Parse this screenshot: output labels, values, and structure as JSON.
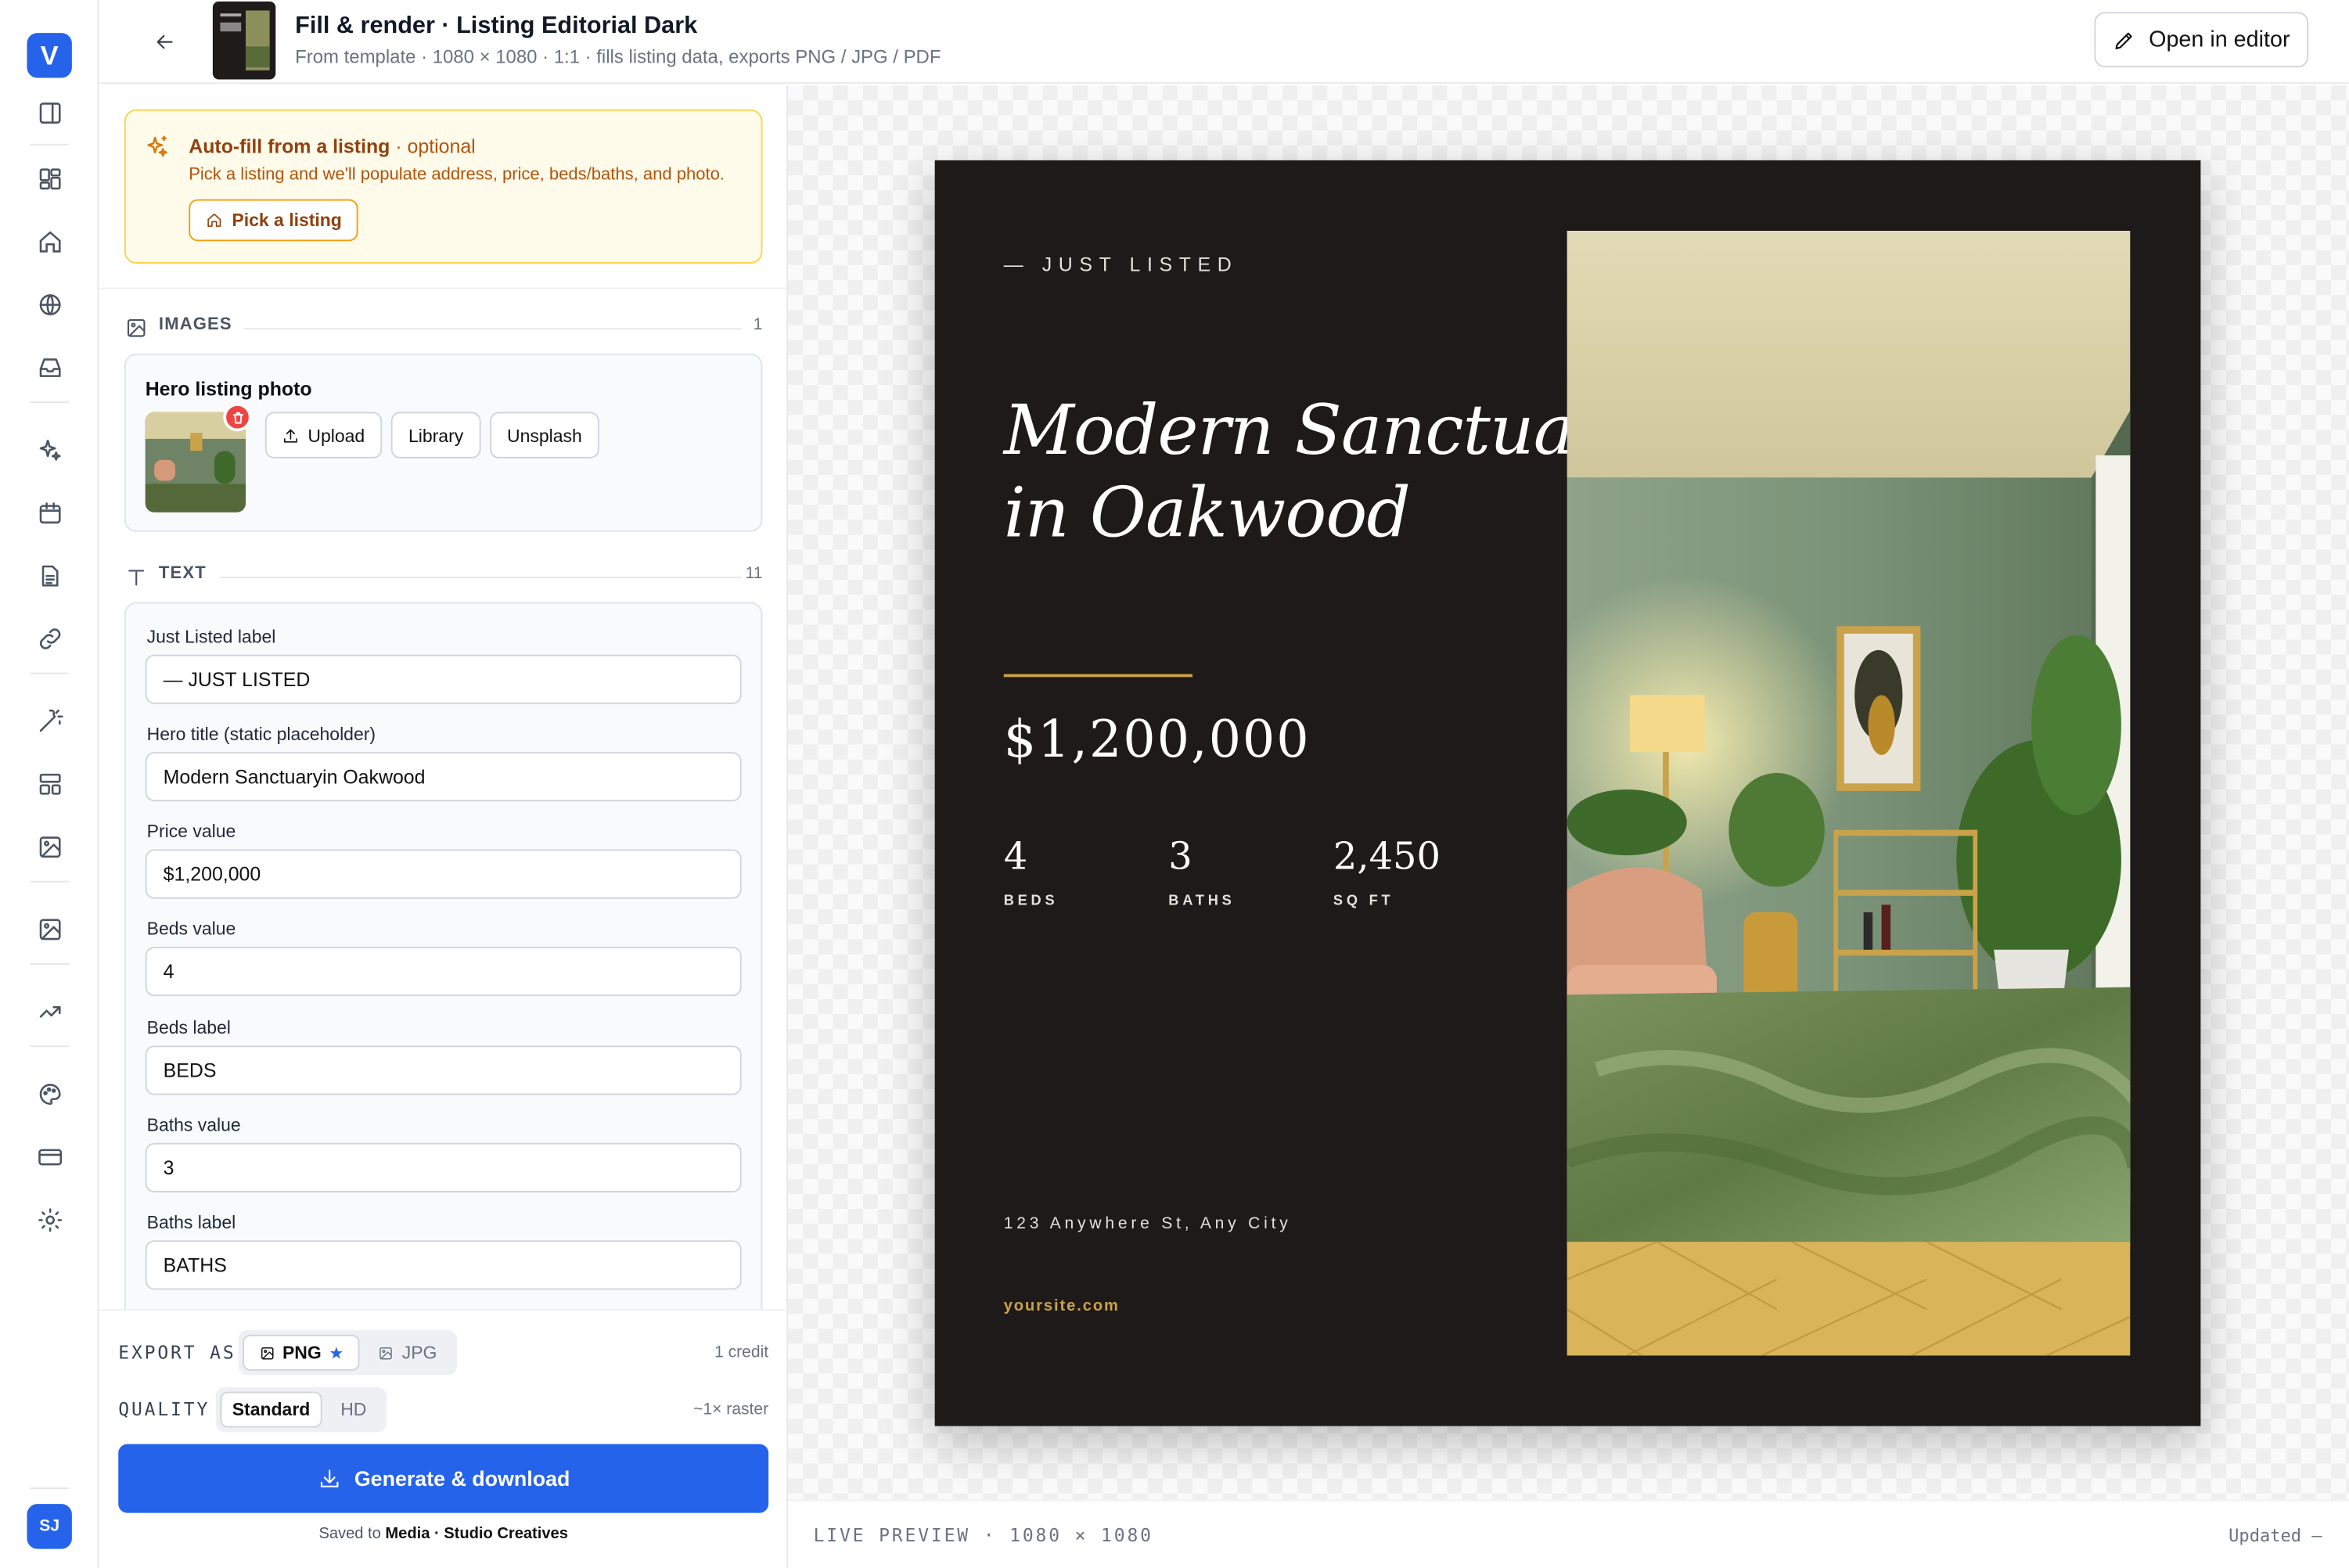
{
  "app": {
    "brand_letter": "V",
    "user_initials": "SJ"
  },
  "rail": {
    "icons": [
      "sidebar-toggle-icon",
      "dashboard-icon",
      "home-icon",
      "globe-icon",
      "inbox-icon",
      "sparkles-icon",
      "calendar-icon",
      "document-icon",
      "link-icon",
      "magic-wand-icon",
      "layout-icon",
      "image-icon",
      "image-gallery-icon",
      "trending-icon",
      "palette-icon",
      "credit-card-icon",
      "settings-icon"
    ]
  },
  "header": {
    "title": "Fill & render · Listing Editorial Dark",
    "subtitle": "From template · 1080 × 1080 · 1:1 · fills listing data, exports PNG / JPG / PDF",
    "open_editor_label": "Open in editor"
  },
  "autofill": {
    "title": "Auto-fill from a listing",
    "optional": " · optional",
    "description": "Pick a listing and we'll populate address, price, beds/baths, and photo.",
    "button_label": "Pick a listing"
  },
  "images_section": {
    "label": "IMAGES",
    "count": "1",
    "card_title": "Hero listing photo",
    "buttons": {
      "upload": "Upload",
      "library": "Library",
      "unsplash": "Unsplash"
    }
  },
  "text_section": {
    "label": "TEXT",
    "count": "11",
    "fields": [
      {
        "label": "Just Listed label",
        "value": "— JUST LISTED"
      },
      {
        "label": "Hero title (static placeholder)",
        "value": "Modern Sanctuaryin Oakwood"
      },
      {
        "label": "Price value",
        "value": "$1,200,000"
      },
      {
        "label": "Beds value",
        "value": "4"
      },
      {
        "label": "Beds label",
        "value": "BEDS"
      },
      {
        "label": "Baths value",
        "value": "3"
      },
      {
        "label": "Baths label",
        "value": "BATHS"
      }
    ]
  },
  "export": {
    "export_as_label": "EXPORT AS",
    "formats": [
      {
        "label": "PNG",
        "selected": true
      },
      {
        "label": "JPG",
        "selected": false
      }
    ],
    "credit": "1 credit",
    "quality_label": "QUALITY",
    "qualities": [
      {
        "label": "Standard",
        "selected": true
      },
      {
        "label": "HD",
        "selected": false
      }
    ],
    "raster": "~1× raster",
    "generate_label": "Generate & download",
    "saved_prefix": "Saved to ",
    "saved_location": "Media · Studio Creatives"
  },
  "preview": {
    "label": "— JUST LISTED",
    "title_line1": "Modern Sanctuary",
    "title_line2": "in Oakwood",
    "price": "$1,200,000",
    "stats": [
      {
        "value": "4",
        "label": "BEDS"
      },
      {
        "value": "3",
        "label": "BATHS"
      },
      {
        "value": "2,450",
        "label": "SQ FT"
      }
    ],
    "address": "123 Anywhere St, Any City",
    "site": "yoursite.com",
    "colors": {
      "background": "#1f1a1a",
      "accent": "#c9a24a",
      "text": "#ffffff"
    }
  },
  "statusbar": {
    "live_preview": "LIVE PREVIEW  ·  1080 × 1080",
    "updated": "Updated —"
  },
  "colors": {
    "primary": "#2563eb",
    "warning_bg": "#fffbeb",
    "warning_border": "#fcd34d",
    "danger": "#ef4444"
  }
}
